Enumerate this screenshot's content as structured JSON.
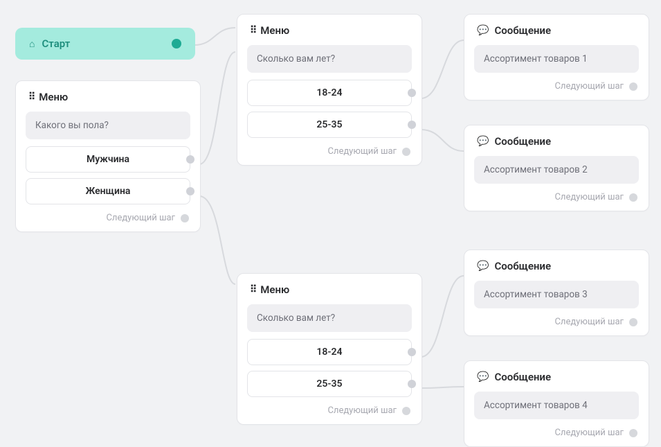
{
  "start": {
    "label": "Старт"
  },
  "menu_title": "Меню",
  "message_title": "Сообщение",
  "next_step_label": "Следующий шаг",
  "menu1": {
    "question": "Какого вы пола?",
    "options": [
      "Мужчина",
      "Женщина"
    ]
  },
  "menu2": {
    "question": "Сколько вам лет?",
    "options": [
      "18-24",
      "25-35"
    ]
  },
  "menu3": {
    "question": "Сколько вам лет?",
    "options": [
      "18-24",
      "25-35"
    ]
  },
  "msg1": {
    "body": "Ассортимент товаров 1"
  },
  "msg2": {
    "body": "Ассортимент товаров 2"
  },
  "msg3": {
    "body": "Ассортимент товаров 3"
  },
  "msg4": {
    "body": "Ассортимент товаров 4"
  }
}
